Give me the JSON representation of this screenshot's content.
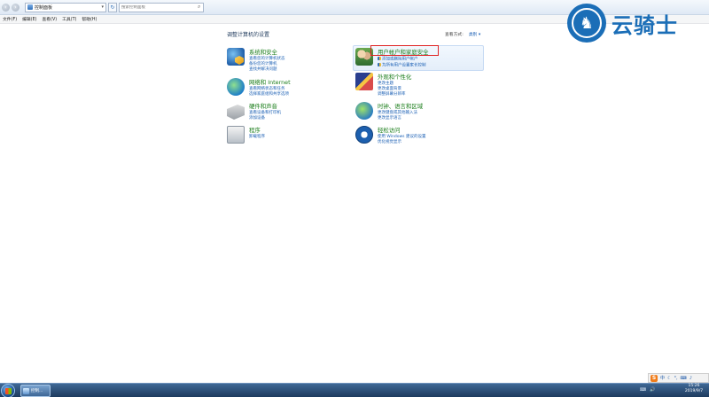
{
  "address_bar": {
    "path_label": "控制面板",
    "search_placeholder": "搜索控制面板"
  },
  "menu": [
    "文件(F)",
    "编辑(E)",
    "查看(V)",
    "工具(T)",
    "帮助(H)"
  ],
  "logo": {
    "text": "云骑士"
  },
  "content": {
    "heading": "调整计算机的设置",
    "view_by_label": "查看方式:",
    "view_by_value": "类别 ▾",
    "categories_left": [
      {
        "title": "系统和安全",
        "icon": "system-security-icon",
        "links": [
          "查看您的计算机状态",
          "备份您的计算机",
          "查找并解决问题"
        ]
      },
      {
        "title": "网络和 Internet",
        "icon": "network-icon",
        "links": [
          "查看网络状态和任务",
          "选择家庭组和共享选项"
        ]
      },
      {
        "title": "硬件和声音",
        "icon": "hardware-sound-icon",
        "links": [
          "查看设备和打印机",
          "添加设备"
        ]
      },
      {
        "title": "程序",
        "icon": "programs-icon",
        "links": [
          "卸载程序"
        ]
      }
    ],
    "categories_right": [
      {
        "title": "用户帐户和家庭安全",
        "icon": "user-accounts-icon",
        "links": [
          "添加或删除用户帐户",
          "为所有用户设置家长控制"
        ]
      },
      {
        "title": "外观和个性化",
        "icon": "appearance-icon",
        "links": [
          "更改主题",
          "更改桌面背景",
          "调整屏幕分辨率"
        ]
      },
      {
        "title": "时钟、语言和区域",
        "icon": "clock-region-icon",
        "links": [
          "更改键盘或其他输入法",
          "更改显示语言"
        ]
      },
      {
        "title": "轻松访问",
        "icon": "ease-of-access-icon",
        "links": [
          "使用 Windows 建议的设置",
          "优化视觉显示"
        ]
      }
    ]
  },
  "taskbar": {
    "task_label": "控制...",
    "tray_float_label": "中",
    "tray_items": [
      "⌨",
      "🔊"
    ],
    "time": "15:26",
    "date": "2019/9/7"
  }
}
